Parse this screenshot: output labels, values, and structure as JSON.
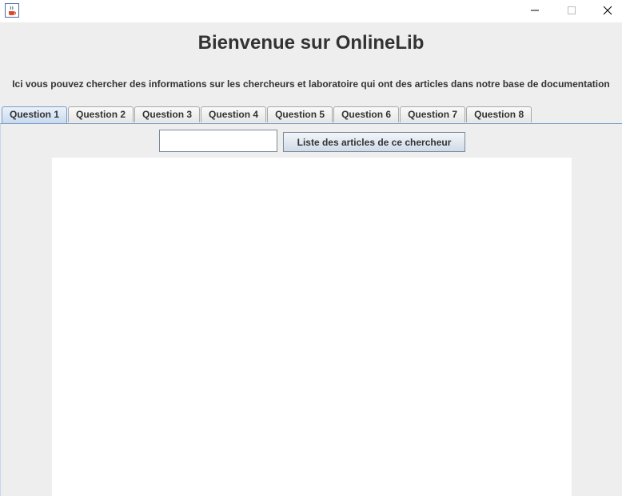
{
  "window": {
    "icon": "java-cup-icon",
    "controls": [
      "minimize-icon",
      "maximize-icon",
      "close-icon"
    ]
  },
  "header": {
    "title": "Bienvenue sur OnlineLib",
    "description": "Ici vous pouvez chercher des informations sur les chercheurs et laboratoire qui ont des articles dans notre base de documentation"
  },
  "tabs": [
    {
      "label": "Question 1",
      "selected": true
    },
    {
      "label": "Question 2",
      "selected": false
    },
    {
      "label": "Question 3",
      "selected": false
    },
    {
      "label": "Question 4",
      "selected": false
    },
    {
      "label": "Question 5",
      "selected": false
    },
    {
      "label": "Question 6",
      "selected": false
    },
    {
      "label": "Question 7",
      "selected": false
    },
    {
      "label": "Question 8",
      "selected": false
    }
  ],
  "question1": {
    "search_value": "",
    "button_label": "Liste des articles de ce chercheur"
  },
  "colors": {
    "accent": "#7a9cc5",
    "background": "#eeeeee",
    "text": "#333333"
  }
}
